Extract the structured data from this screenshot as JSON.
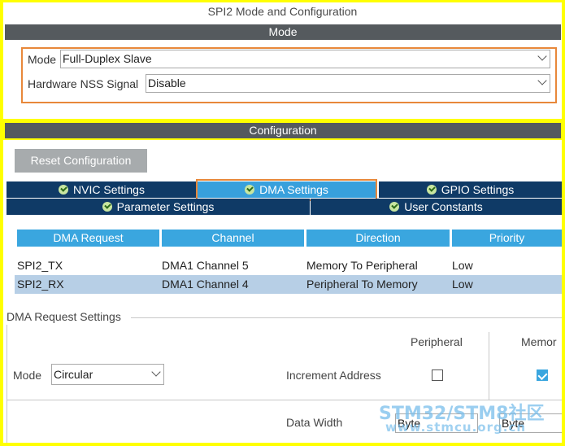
{
  "window": {
    "title": "SPI2 Mode and Configuration"
  },
  "mode_section": {
    "header": "Mode",
    "mode_label": "Mode",
    "mode_value": "Full-Duplex Slave",
    "nss_label": "Hardware NSS Signal",
    "nss_value": "Disable"
  },
  "config_section": {
    "header": "Configuration",
    "reset_button": "Reset Configuration",
    "tabs": [
      {
        "label": "NVIC Settings",
        "icon": "check-circle-icon"
      },
      {
        "label": "DMA Settings",
        "icon": "check-circle-icon",
        "active": true
      },
      {
        "label": "GPIO Settings",
        "icon": "check-circle-icon"
      },
      {
        "label": "Parameter Settings",
        "icon": "check-circle-icon"
      },
      {
        "label": "User Constants",
        "icon": "check-circle-icon"
      }
    ]
  },
  "dma_table": {
    "columns": [
      "DMA Request",
      "Channel",
      "Direction",
      "Priority"
    ],
    "rows": [
      {
        "request": "SPI2_TX",
        "channel": "DMA1 Channel 5",
        "direction": "Memory To Peripheral",
        "priority": "Low"
      },
      {
        "request": "SPI2_RX",
        "channel": "DMA1 Channel 4",
        "direction": "Peripheral To Memory",
        "priority": "Low",
        "selected": true
      }
    ]
  },
  "request_settings": {
    "legend": "DMA Request Settings",
    "peripheral_header": "Peripheral",
    "memory_header": "Memor",
    "mode_label": "Mode",
    "mode_value": "Circular",
    "increment_label": "Increment Address",
    "peripheral_increment": false,
    "memory_increment": true,
    "data_width_label": "Data Width",
    "peripheral_width": "Byte",
    "memory_width": "Byte"
  },
  "watermark": {
    "line1": "STM32/STM8社区",
    "line2": "www.stmcu.org.cn"
  },
  "colors": {
    "highlight": "#e8883a",
    "tab_bg": "#0f3a66",
    "tab_active": "#38a0dc",
    "table_header": "#3aa6df",
    "selected_row": "#b7cfe6",
    "frame": "#ffff00"
  }
}
